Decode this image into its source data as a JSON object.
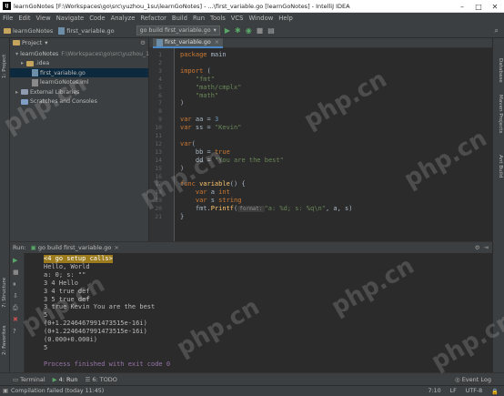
{
  "window": {
    "title": "learnGoNotes [F:\\Workspaces\\go\\src\\yuzhou_1su\\learnGoNotes] - ...\\first_variable.go [learnGoNotes] - IntelliJ IDEA",
    "logo": "IJ",
    "minimize": "–",
    "maximize": "□",
    "close": "✕"
  },
  "menu": [
    "File",
    "Edit",
    "View",
    "Navigate",
    "Code",
    "Analyze",
    "Refactor",
    "Build",
    "Run",
    "Tools",
    "VCS",
    "Window",
    "Help"
  ],
  "toolbar": {
    "breadcrumb_project": "learnGoNotes",
    "breadcrumb_file": "first_variable.go",
    "run_config": "go build first_variable.go"
  },
  "project_panel": {
    "header": "Project",
    "tree": [
      {
        "label": "learnGoNotes",
        "extra": "F:\\Workspaces\\go\\src\\yuzhou_1su\\l",
        "indent": 1,
        "type": "folder",
        "arrow": "▾"
      },
      {
        "label": ".idea",
        "extra": "",
        "indent": 2,
        "type": "folder",
        "arrow": "▸"
      },
      {
        "label": "first_variable.go",
        "extra": "",
        "indent": 3,
        "type": "go",
        "arrow": "",
        "selected": true
      },
      {
        "label": "learnGoNotes.iml",
        "extra": "",
        "indent": 3,
        "type": "iml",
        "arrow": ""
      },
      {
        "label": "External Libraries",
        "extra": "",
        "indent": 1,
        "type": "lib",
        "arrow": "▸"
      },
      {
        "label": "Scratches and Consoles",
        "extra": "",
        "indent": 1,
        "type": "scratch",
        "arrow": ""
      }
    ]
  },
  "editor": {
    "tab_label": "first_variable.go",
    "line_numbers": [
      "1",
      "2",
      "3",
      "4",
      "5",
      "6",
      "7",
      "8",
      "9",
      "10",
      "11",
      "12",
      "13",
      "14",
      "15",
      "16",
      "17",
      "18",
      "19",
      "20",
      "21"
    ],
    "lines": [
      [
        {
          "c": "kw",
          "t": "package "
        },
        {
          "c": "plain",
          "t": "main"
        }
      ],
      [],
      [
        {
          "c": "kw",
          "t": "import "
        },
        {
          "c": "plain",
          "t": "("
        }
      ],
      [
        {
          "c": "plain",
          "t": "    "
        },
        {
          "c": "str",
          "t": "\"fmt\""
        }
      ],
      [
        {
          "c": "plain",
          "t": "    "
        },
        {
          "c": "str",
          "t": "\"math/cmplx\""
        }
      ],
      [
        {
          "c": "plain",
          "t": "    "
        },
        {
          "c": "str",
          "t": "\"math\""
        }
      ],
      [
        {
          "c": "plain",
          "t": ")"
        }
      ],
      [],
      [
        {
          "c": "kw",
          "t": "var "
        },
        {
          "c": "plain",
          "t": "aa = "
        },
        {
          "c": "num",
          "t": "3"
        }
      ],
      [
        {
          "c": "kw",
          "t": "var "
        },
        {
          "c": "plain",
          "t": "ss = "
        },
        {
          "c": "str",
          "t": "\"Kevin\""
        }
      ],
      [],
      [
        {
          "c": "kw",
          "t": "var"
        },
        {
          "c": "plain",
          "t": "("
        }
      ],
      [
        {
          "c": "plain",
          "t": "    bb = "
        },
        {
          "c": "kw",
          "t": "true"
        }
      ],
      [
        {
          "c": "plain",
          "t": "    dd = "
        },
        {
          "c": "str",
          "t": "\"You are the best\""
        }
      ],
      [
        {
          "c": "plain",
          "t": ")"
        }
      ],
      [],
      [
        {
          "c": "kw",
          "t": "func "
        },
        {
          "c": "fn",
          "t": "variable"
        },
        {
          "c": "plain",
          "t": "() {"
        }
      ],
      [
        {
          "c": "plain",
          "t": "    "
        },
        {
          "c": "kw",
          "t": "var "
        },
        {
          "c": "plain",
          "t": "a "
        },
        {
          "c": "kw",
          "t": "int"
        }
      ],
      [
        {
          "c": "plain",
          "t": "    "
        },
        {
          "c": "kw",
          "t": "var "
        },
        {
          "c": "plain",
          "t": "s "
        },
        {
          "c": "kw",
          "t": "string"
        }
      ],
      [
        {
          "c": "plain",
          "t": "    fmt."
        },
        {
          "c": "fn",
          "t": "Printf"
        },
        {
          "c": "plain",
          "t": "("
        },
        {
          "c": "hint",
          "t": "format:"
        },
        {
          "c": "str",
          "t": "\"a: %d; s: %q\\n\""
        },
        {
          "c": "plain",
          "t": ", a, s)"
        }
      ],
      [
        {
          "c": "plain",
          "t": "}"
        }
      ]
    ]
  },
  "run_panel": {
    "run_label": "Run:",
    "tab_label": "go build first_variable.go",
    "output": [
      {
        "t": "<4 go setup calls>",
        "style": "hl"
      },
      {
        "t": "Hello, World",
        "style": ""
      },
      {
        "t": "a: 0; s: \"\"",
        "style": ""
      },
      {
        "t": "3 4 Hello",
        "style": ""
      },
      {
        "t": "3 4 true def",
        "style": ""
      },
      {
        "t": "3 5 true def",
        "style": ""
      },
      {
        "t": "3 true Kevin You are the best",
        "style": ""
      },
      {
        "t": "5",
        "style": ""
      },
      {
        "t": "(0+1.2246467991473515e-16i)",
        "style": ""
      },
      {
        "t": "(0+1.2246467991473515e-16i)",
        "style": ""
      },
      {
        "t": "(0.000+0.000i)",
        "style": ""
      },
      {
        "t": "5",
        "style": ""
      },
      {
        "t": "",
        "style": ""
      },
      {
        "t": "Process finished with exit code 0",
        "style": "exit"
      }
    ]
  },
  "bottom_tabs": [
    "Terminal",
    "4: Run",
    "6: TODO"
  ],
  "event_log": "Event Log",
  "status": {
    "message": "Compilation failed (today 11:45)",
    "position": "7:10",
    "line_sep": "LF",
    "encoding": "UTF-8"
  },
  "side_labels": {
    "project": "1: Project",
    "favorites": "2: Favorites",
    "structure": "7: Structure",
    "database": "Database",
    "maven": "Maven Projects",
    "ant": "Ant Build"
  },
  "watermark": "php.cn",
  "colors": {
    "accent": "#4a88c7",
    "keyword": "#cc7832",
    "string": "#6a8759",
    "number": "#6897bb",
    "run_green": "#59a869",
    "stop_red": "#c75450"
  }
}
